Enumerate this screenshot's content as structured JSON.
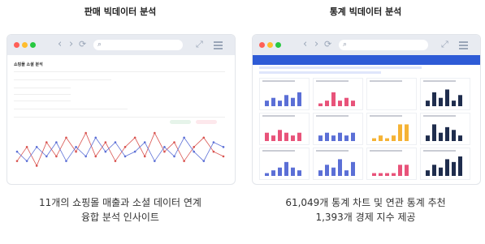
{
  "left_panel": {
    "title": "판매 빅데이터 분석",
    "page_heading": "쇼핑몰 소셜 분석",
    "caption_line1": "11개의 쇼핑몰 매출과 소셜 데이터 연계",
    "caption_line2": "융합 분석 인사이트"
  },
  "right_panel": {
    "title": "통계 빅데이터 분석",
    "caption_line1": "61,049개 통계 차트 및 연관 통계 추천",
    "caption_line2": "1,393개 경제 지수 제공"
  },
  "chrome": {
    "back": "‹",
    "forward": "›",
    "reload": "⟳",
    "search_icon": "search-icon",
    "expand_icon": "expand-icon",
    "menu_icon": "hamburger-menu-icon",
    "dot_colors": {
      "red": "#ff5f57",
      "yellow": "#ffbd2e",
      "green": "#28c840"
    }
  },
  "colors": {
    "red_series": "#d9534f",
    "blue_series": "#5b6fd6",
    "accent_blue": "#2e5bd6",
    "yellow_bar": "#f5b335",
    "pink_bar": "#e8537a",
    "dark_bar": "#1f2d4d"
  },
  "chart_data": {
    "type": "line",
    "series": [
      {
        "values": [
          3,
          6,
          2,
          7,
          4,
          8,
          5,
          9,
          4,
          7,
          3,
          6,
          8,
          4,
          9,
          5,
          7,
          3,
          6,
          8,
          5,
          4
        ]
      },
      {
        "values": [
          5,
          3,
          6,
          4,
          7,
          3,
          6,
          4,
          8,
          5,
          7,
          4,
          5,
          7,
          3,
          6,
          4,
          8,
          5,
          3,
          7,
          6
        ]
      }
    ]
  },
  "mini_tiles": [
    {
      "bars": [
        2,
        3,
        2,
        4,
        3,
        5
      ],
      "color": "#5b6fd6"
    },
    {
      "bars": [
        1,
        2,
        5,
        2,
        3,
        2
      ],
      "color": "#e8537a"
    },
    {
      "bars": [
        0,
        0,
        0,
        0,
        0,
        0
      ],
      "color": "#5b6fd6"
    },
    {
      "bars": [
        2,
        5,
        3,
        6,
        2,
        4
      ],
      "color": "#1f2d4d"
    },
    {
      "bars": [
        3,
        2,
        4,
        3,
        2,
        3
      ],
      "color": "#e8537a"
    },
    {
      "bars": [
        2,
        3,
        2,
        3,
        2,
        3
      ],
      "color": "#5b6fd6"
    },
    {
      "bars": [
        1,
        2,
        1,
        2,
        6,
        6
      ],
      "color": "#f5b335"
    },
    {
      "bars": [
        2,
        6,
        3,
        5,
        4,
        2
      ],
      "color": "#1f2d4d"
    },
    {
      "bars": [
        1,
        2,
        3,
        5,
        3,
        2
      ],
      "color": "#5b6fd6"
    },
    {
      "bars": [
        2,
        4,
        3,
        6,
        2,
        5
      ],
      "color": "#5b6fd6"
    },
    {
      "bars": [
        1,
        1,
        1,
        1,
        4,
        4
      ],
      "color": "#e8537a"
    },
    {
      "bars": [
        2,
        4,
        3,
        6,
        5,
        7
      ],
      "color": "#1f2d4d"
    }
  ]
}
